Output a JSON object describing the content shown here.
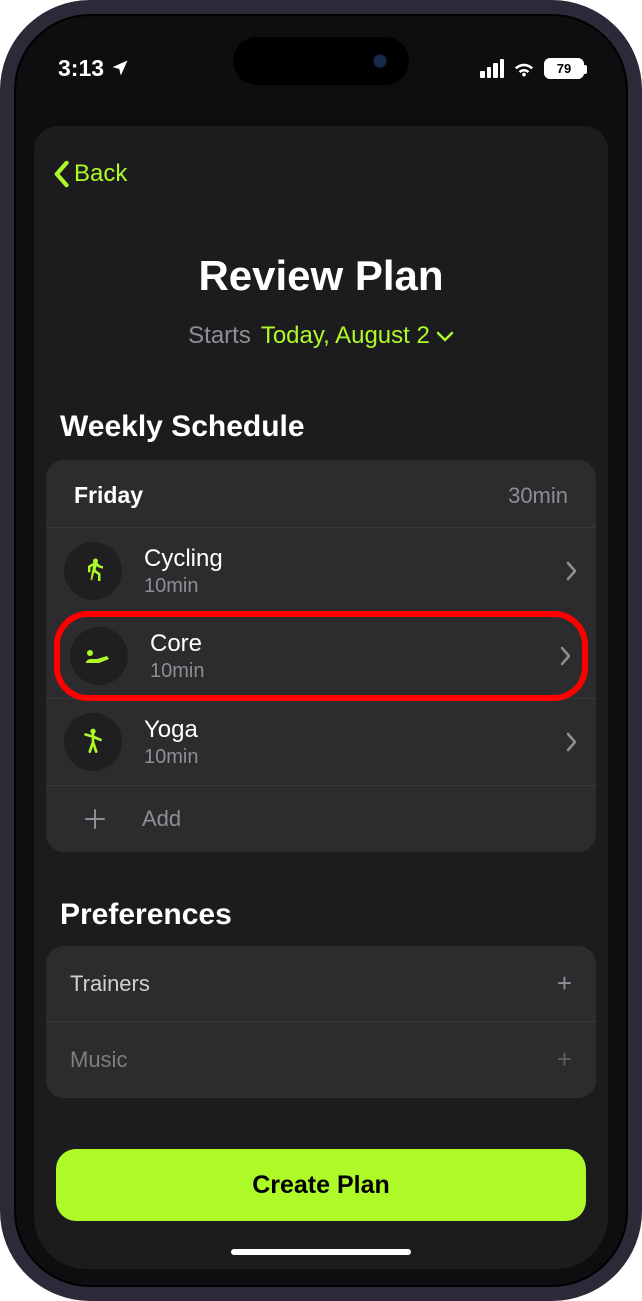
{
  "status": {
    "time": "3:13",
    "battery": "79"
  },
  "nav": {
    "back": "Back"
  },
  "page": {
    "title": "Review Plan",
    "starts_label": "Starts",
    "starts_value": "Today, August 2"
  },
  "weekly": {
    "header": "Weekly Schedule",
    "day": "Friday",
    "day_total": "30min",
    "items": [
      {
        "name": "Cycling",
        "duration": "10min"
      },
      {
        "name": "Core",
        "duration": "10min"
      },
      {
        "name": "Yoga",
        "duration": "10min"
      }
    ],
    "add_label": "Add"
  },
  "prefs": {
    "header": "Preferences",
    "rows": [
      {
        "label": "Trainers"
      },
      {
        "label": "Music"
      }
    ]
  },
  "cta": {
    "create": "Create Plan"
  }
}
